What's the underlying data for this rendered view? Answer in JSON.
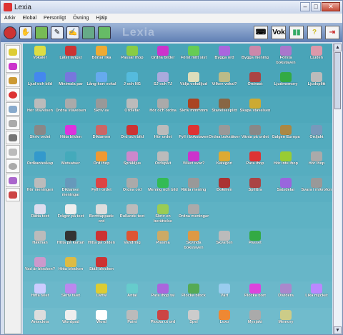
{
  "window": {
    "title": "Lexia"
  },
  "menus": [
    "Arkiv",
    "Elobal",
    "Personligt",
    "Övning",
    "Hjälp"
  ],
  "toolbar_right": [
    "Vok",
    "chart",
    "?",
    "exit"
  ],
  "rows": [
    {
      "bg": "#49a4b8",
      "tiles": [
        [
          "Vokaler",
          "#dd4"
        ],
        [
          "Låter längst",
          "#c33"
        ],
        [
          "Börjar lika",
          "#ea3"
        ],
        [
          "Passar ihop",
          "#8c4"
        ],
        [
          "Ordna bilder",
          "#c3c"
        ],
        [
          "Först mitt sist",
          "#6c5"
        ],
        [
          "Bygga ord",
          "#a6d"
        ],
        [
          "Bygga mening",
          "#c8a"
        ],
        [
          "Första bokstaven",
          "#a7c"
        ],
        [
          "Ljuden",
          "#d9a"
        ]
      ]
    },
    {
      "bg": "#4aa5b9",
      "tiles": [
        [
          "Ljud och bild",
          "#48e"
        ],
        [
          "Minimala par",
          "#77d"
        ],
        [
          "Lång-kort vokal",
          "#6ae"
        ],
        [
          "J och NG",
          "#5bd"
        ],
        [
          "SJ och TJ",
          "#aad"
        ],
        [
          "Välja vokalljud",
          "#ddb"
        ],
        [
          "Vilken vokal?",
          "#bb8"
        ],
        [
          "Ordnast",
          "#a44"
        ],
        [
          "Ljudmemory",
          "#3a4"
        ],
        [
          "Ljudsplitt",
          "#bbb"
        ]
      ]
    },
    {
      "bg": "#4ea8bb",
      "tiles": [
        [
          "Hör stavelsen",
          "#bbb"
        ],
        [
          "Ordna stavelsen",
          "#aaa"
        ],
        [
          "Skriv av",
          "#999"
        ],
        [
          "Ordletar",
          "#bbb"
        ],
        [
          "Hör och ordna",
          "#aaa"
        ],
        [
          "Skriv mmmmm",
          "#a42"
        ],
        [
          "Stavelsesplitt",
          "#864"
        ],
        [
          "Skapa stavelsen",
          "#ca3"
        ]
      ]
    },
    {
      "bg": "#52abbe",
      "tiles": [
        [
          "Skriv ordet",
          "#888"
        ],
        [
          "Hitta bilden",
          "#d3d"
        ],
        [
          "Diktamen",
          "#c66"
        ],
        [
          "Ord och bild",
          "#c33"
        ],
        [
          "Hör ordet",
          "#bbb"
        ],
        [
          "Fyll i bokstaven",
          "#d33"
        ],
        [
          "Ordna bokstäver",
          "#999"
        ],
        [
          "Vänta på ordet",
          "#888"
        ],
        [
          "Galgen Europa",
          "#a84"
        ],
        [
          "Ordjakt",
          "#79b"
        ]
      ]
    },
    {
      "bg": "#56adc0",
      "tiles": [
        [
          "Ordkanteskap",
          "#39c"
        ],
        [
          "Motsatser",
          "#4ab"
        ],
        [
          "Ord ihop",
          "#e93"
        ],
        [
          "Språkljus",
          "#c8c"
        ],
        [
          "Ordspålt",
          "#bbb"
        ],
        [
          "Vilket svar?",
          "#c3c"
        ],
        [
          "Kategori",
          "#da3"
        ],
        [
          "Para ihop",
          "#d33"
        ],
        [
          "Hör inte ihop",
          "#9c3"
        ],
        [
          "Hör ihop",
          "#aaa"
        ]
      ]
    },
    {
      "bg": "#5aafc2",
      "tiles": [
        [
          "Hör meningen",
          "#bbb"
        ],
        [
          "Diktamen meningar",
          "#69b"
        ],
        [
          "Fyll i ordet",
          "#d44"
        ],
        [
          "Ordna ord",
          "#aaa"
        ],
        [
          "Mening och bild",
          "#3b5"
        ],
        [
          "Rätta mening",
          "#999"
        ],
        [
          "Dokmen",
          "#a33"
        ],
        [
          "Splittra",
          "#a44"
        ],
        [
          "Satsdelar",
          "#96d"
        ],
        [
          "Svara i mikrofon",
          "#999"
        ]
      ]
    },
    {
      "bg": "#5eb2c4",
      "tiles": [
        [
          "Rätta text",
          "#dde"
        ],
        [
          "Frågor på text",
          "#eee"
        ],
        [
          "Bortttappade ord",
          "#ddd"
        ],
        [
          "Rullande text",
          "#bbb"
        ],
        [
          "Skriv en berättelse",
          "#9c5"
        ],
        [
          "Ordna meningar",
          "#aaa"
        ]
      ]
    },
    {
      "bg": "#62b4c6",
      "tiles": [
        [
          "Håkman",
          "#bbb"
        ],
        [
          "Hitta på kartan",
          "#333"
        ],
        [
          "Hitta på bilden",
          "#c33"
        ],
        [
          "Vandring",
          "#d53"
        ],
        [
          "Plasma",
          "#ca6"
        ],
        [
          "Skymda bokstaven",
          "#d94"
        ],
        [
          "Skyarten",
          "#bbb"
        ],
        [
          "Passet",
          "#3a4"
        ]
      ]
    },
    {
      "bg": "#67b6c8",
      "tiles": [
        [
          "Vad är blocken?",
          "#c9c"
        ],
        [
          "Hitta blocken",
          "#db4"
        ],
        [
          "Ställ blocken",
          "#c33"
        ]
      ]
    },
    {
      "bg": "#6bb8ca",
      "tiles": [
        [
          "Hitta talet",
          "#ccf"
        ],
        [
          "Skriv talet",
          "#b8e"
        ],
        [
          "Lärtal",
          "#dc3"
        ],
        [
          "Antal",
          "#6cc"
        ],
        [
          "Para ihop tal",
          "#a6d"
        ],
        [
          "Plocka block",
          "#5a5"
        ],
        [
          "Värt",
          "#9ce"
        ],
        [
          "Plocka bort",
          "#d4d"
        ],
        [
          "Dividera",
          "#a8c"
        ],
        [
          "Lika mycket",
          "#b8f"
        ]
      ]
    },
    {
      "bg": "#70bbcc",
      "tiles": [
        [
          "Anteckna",
          "#ddd"
        ],
        [
          "Wordpad",
          "#eee"
        ],
        [
          "Word",
          "#fff"
        ],
        [
          "Paint",
          "#bbb"
        ],
        [
          "Plocka ut ord",
          "#c44"
        ],
        [
          "Spel",
          "#ccc"
        ],
        [
          "Lexo",
          "#e83"
        ],
        [
          "Mysjakt",
          "#aaa"
        ],
        [
          "Memory",
          "#cc8"
        ]
      ]
    }
  ],
  "colors": {
    "toolbar": "#6a89be",
    "accent": "#c33"
  }
}
